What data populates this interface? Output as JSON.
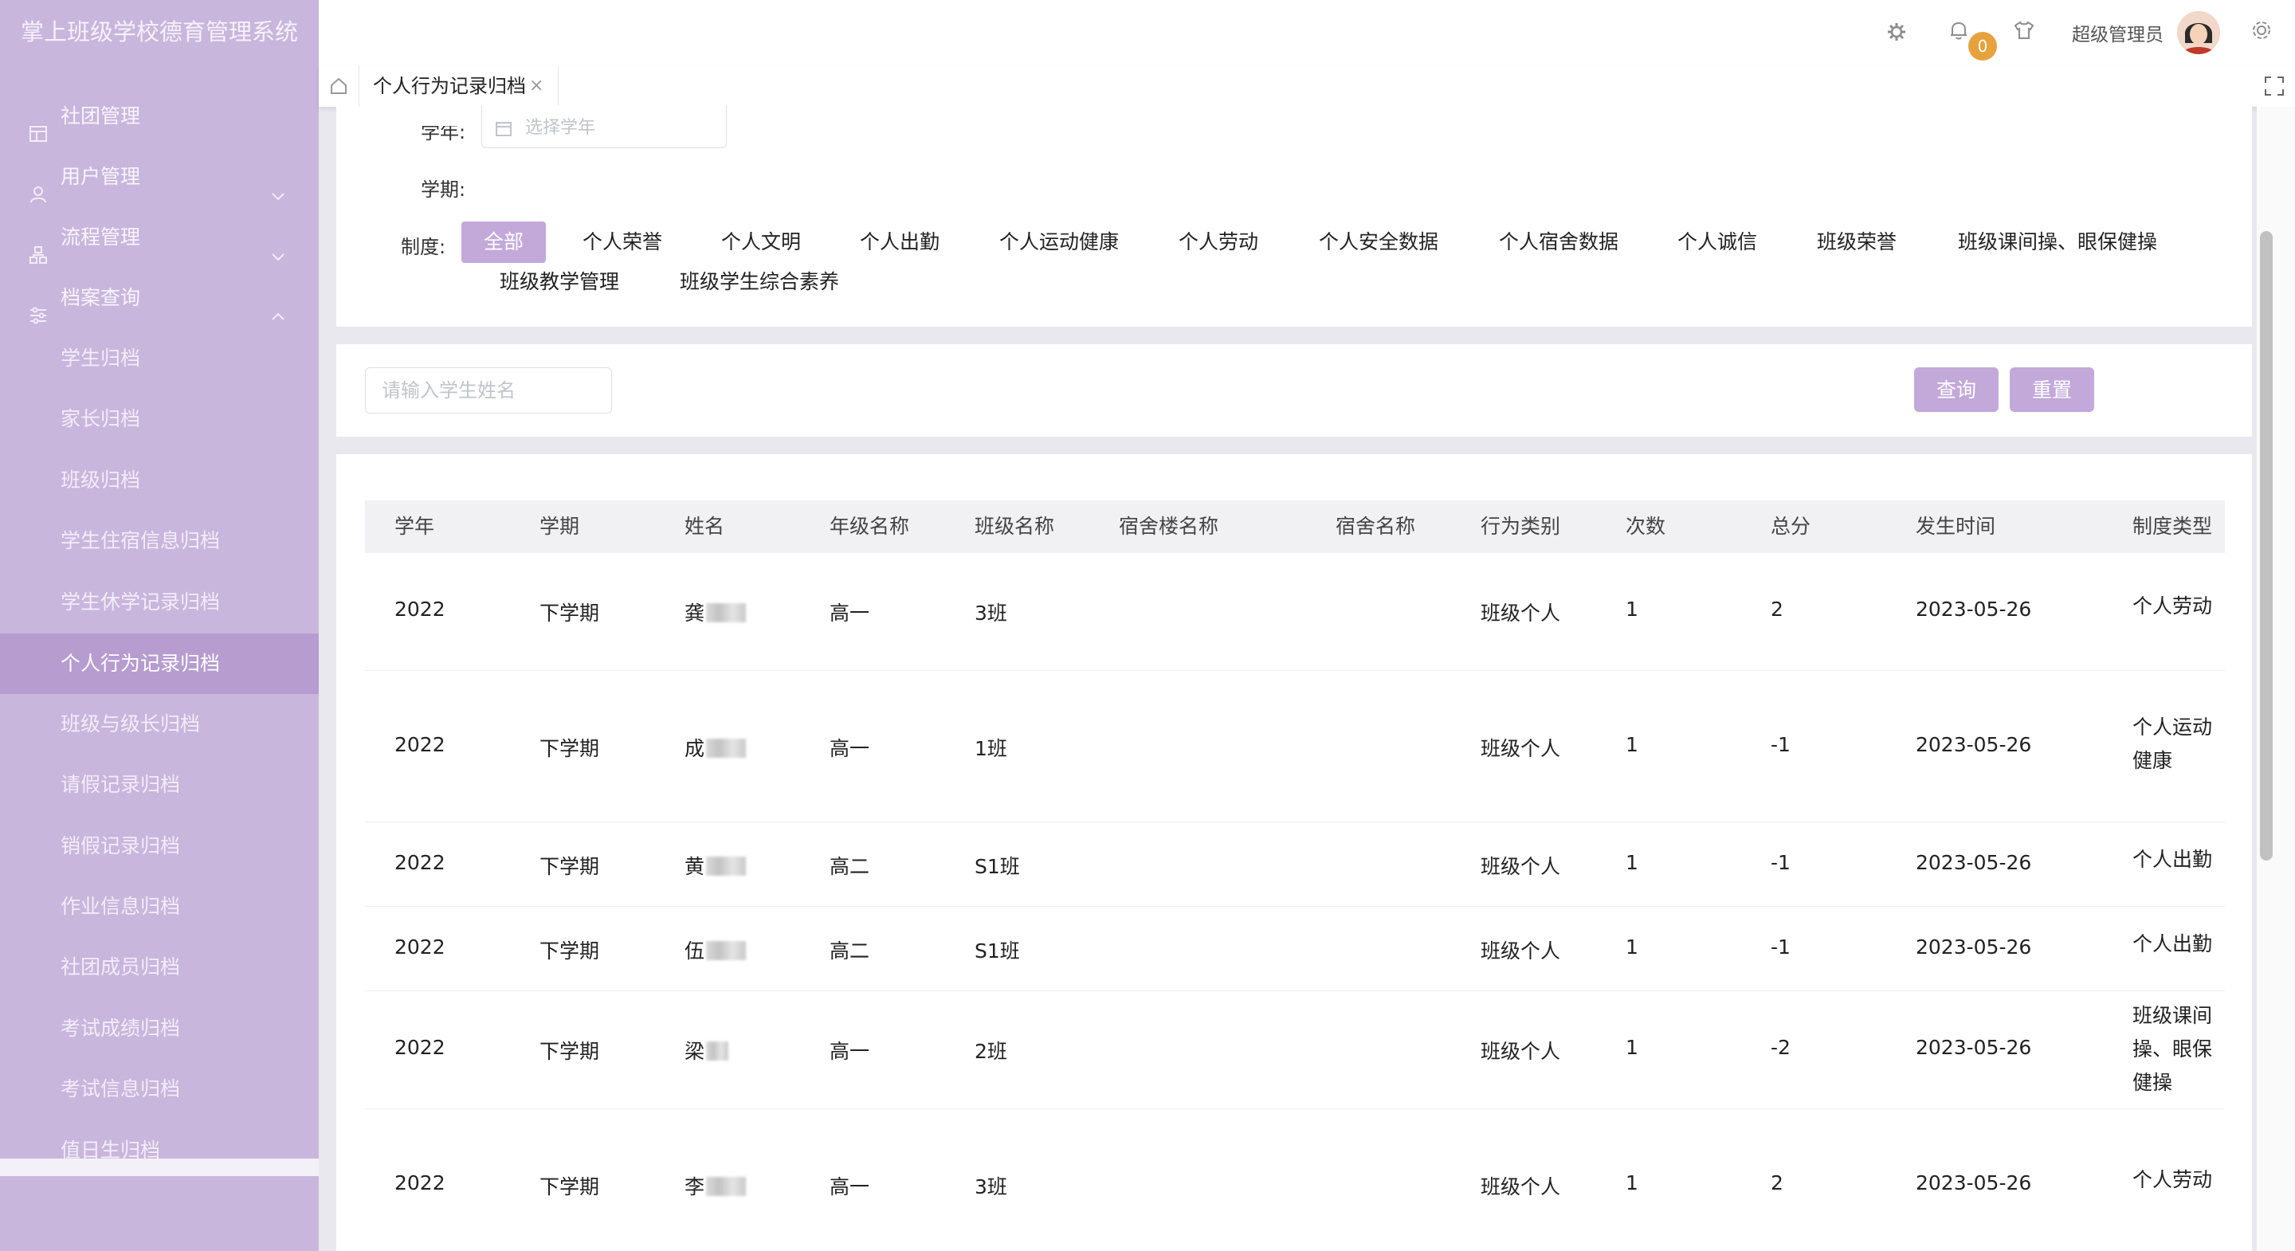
{
  "app": {
    "title": "掌上班级学校德育管理系统"
  },
  "sidebar": {
    "menus": [
      {
        "label": "社团管理",
        "icon": "table-icon"
      },
      {
        "label": "用户管理",
        "icon": "user-icon"
      },
      {
        "label": "流程管理",
        "icon": "flow-icon"
      },
      {
        "label": "档案查询",
        "icon": "sliders-icon"
      }
    ],
    "sub_items": [
      "学生归档",
      "家长归档",
      "班级归档",
      "学生住宿信息归档",
      "学生休学记录归档",
      "个人行为记录归档",
      "班级与级长归档",
      "请假记录归档",
      "销假记录归档",
      "作业信息归档",
      "社团成员归档",
      "考试成绩归档",
      "考试信息归档",
      "值日生归档"
    ],
    "active_sub_item": "个人行为记录归档"
  },
  "header": {
    "notification_count": "0",
    "admin_name": "超级管理员"
  },
  "tabs": {
    "active_tab": "个人行为记录归档",
    "close_glyph": "×"
  },
  "filters": {
    "year_label": "学年:",
    "year_placeholder": "选择学年",
    "term_label": "学期:",
    "system_label": "制度:",
    "system_options": [
      "全部",
      "个人荣誉",
      "个人文明",
      "个人出勤",
      "个人运动健康",
      "个人劳动",
      "个人安全数据",
      "个人宿舍数据",
      "个人诚信",
      "班级荣誉",
      "班级课间操、眼保健操",
      "班级教学管理",
      "班级学生综合素养"
    ],
    "selected_system": "全部"
  },
  "search": {
    "placeholder": "请输入学生姓名",
    "query_label": "查询",
    "reset_label": "重置"
  },
  "table": {
    "columns": [
      "学年",
      "学期",
      "姓名",
      "年级名称",
      "班级名称",
      "宿舍楼名称",
      "宿舍名称",
      "行为类别",
      "次数",
      "总分",
      "发生时间",
      "制度类型"
    ],
    "rows": [
      {
        "year": "2022",
        "term": "下学期",
        "surname": "龚",
        "grade": "高一",
        "class": "3班",
        "building": "",
        "dorm": "",
        "category": "班级个人",
        "count": "1",
        "score": "2",
        "time": "2023-05-26",
        "type": "个人劳动"
      },
      {
        "year": "2022",
        "term": "下学期",
        "surname": "成",
        "grade": "高一",
        "class": "1班",
        "building": "",
        "dorm": "",
        "category": "班级个人",
        "count": "1",
        "score": "-1",
        "time": "2023-05-26",
        "type": "个人运动健康"
      },
      {
        "year": "2022",
        "term": "下学期",
        "surname": "黄",
        "grade": "高二",
        "class": "S1班",
        "building": "",
        "dorm": "",
        "category": "班级个人",
        "count": "1",
        "score": "-1",
        "time": "2023-05-26",
        "type": "个人出勤"
      },
      {
        "year": "2022",
        "term": "下学期",
        "surname": "伍",
        "grade": "高二",
        "class": "S1班",
        "building": "",
        "dorm": "",
        "category": "班级个人",
        "count": "1",
        "score": "-1",
        "time": "2023-05-26",
        "type": "个人出勤"
      },
      {
        "year": "2022",
        "term": "下学期",
        "surname": "梁",
        "grade": "高一",
        "class": "2班",
        "building": "",
        "dorm": "",
        "category": "班级个人",
        "count": "1",
        "score": "-2",
        "time": "2023-05-26",
        "type": "班级课间操、眼保健操"
      },
      {
        "year": "2022",
        "term": "下学期",
        "surname": "李",
        "grade": "高一",
        "class": "3班",
        "building": "",
        "dorm": "",
        "category": "班级个人",
        "count": "1",
        "score": "2",
        "time": "2023-05-26",
        "type": "个人劳动"
      }
    ]
  },
  "colors": {
    "sidebar_bg": "#c9b6dc",
    "sidebar_active": "#b69ccf",
    "accent": "#c2a9da",
    "badge": "#e6a23c"
  }
}
